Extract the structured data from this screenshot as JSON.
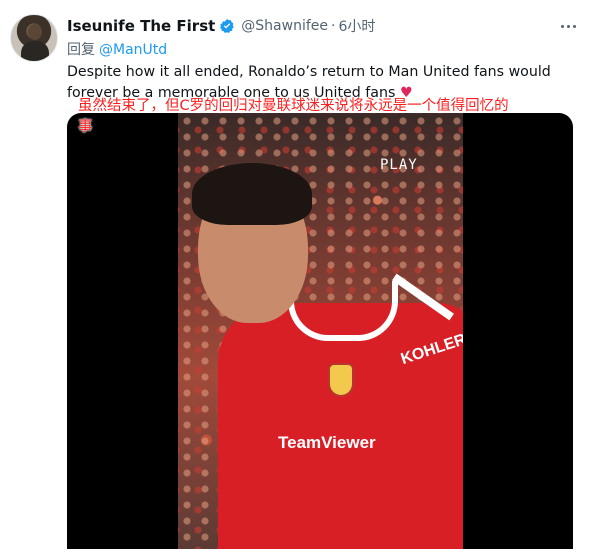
{
  "tweet": {
    "author_name": "Iseunife The First",
    "author_handle": "@Shawnifee",
    "separator": "·",
    "time": "6小时",
    "reply_prefix": "回复",
    "reply_mention": "@ManUtd",
    "text": "Despite how it all ended, Ronaldo’s return to Man United fans would forever be a memorable one to us United fans",
    "heart": "♥",
    "overlay_caption": "虽然结束了，但C罗的回归对曼联球迷来说将永远是一个值得回忆的事"
  },
  "media": {
    "play_label": "PLAY",
    "sponsor_text": "TeamViewer",
    "sleeve_text": "KOHLER"
  },
  "colors": {
    "link_blue": "#1d9bf0",
    "muted_gray": "#536471",
    "overlay_red": "#ff1e1e",
    "shirt_red": "#d81f26"
  },
  "icons": {
    "verified": "verified-badge-icon",
    "more": "more-dots-icon"
  }
}
